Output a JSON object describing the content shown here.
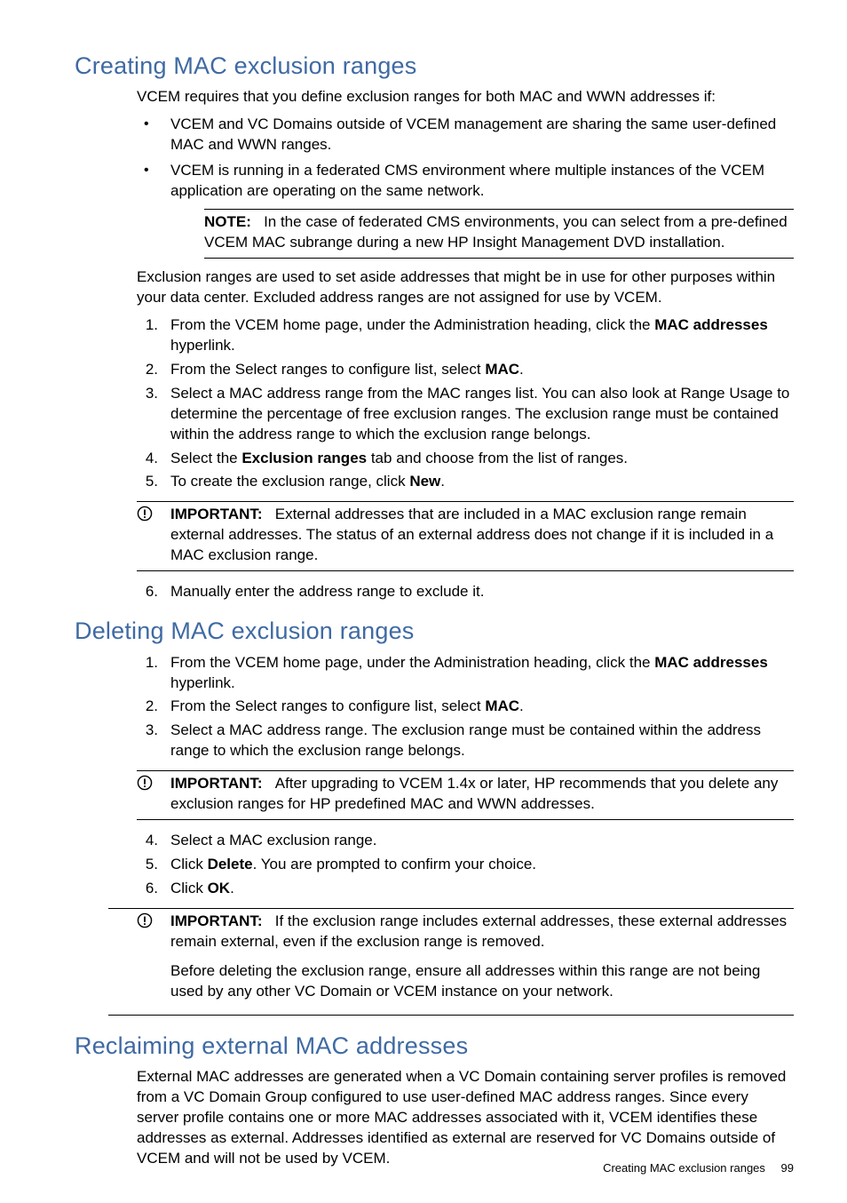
{
  "section1": {
    "heading": "Creating MAC exclusion ranges",
    "intro": "VCEM requires that you define exclusion ranges for both MAC and WWN addresses if:",
    "bullets": [
      "VCEM and VC Domains outside of VCEM management are sharing the same user-defined MAC and WWN ranges.",
      "VCEM is running in a federated CMS environment where multiple instances of the VCEM application are operating on the same network."
    ],
    "note_label": "NOTE:",
    "note_body": "In the case of federated CMS environments, you can select from a pre-defined VCEM MAC subrange during a new HP Insight Management DVD installation.",
    "para2": "Exclusion ranges are used to set aside addresses that might be in use for other purposes within your data center. Excluded address ranges are not assigned for use by VCEM.",
    "steps": {
      "s1a": "From the VCEM home page, under the Administration heading, click the ",
      "s1b": "MAC addresses",
      "s1c": " hyperlink.",
      "s2a": "From the Select ranges to configure list, select ",
      "s2b": "MAC",
      "s2c": ".",
      "s3": "Select a MAC address range from the MAC ranges list. You can also look at Range Usage to determine the percentage of free exclusion ranges. The exclusion range must be contained within the address range to which the exclusion range belongs.",
      "s4a": "Select the ",
      "s4b": "Exclusion ranges",
      "s4c": " tab and choose from the list of ranges.",
      "s5a": "To create the exclusion range, click ",
      "s5b": "New",
      "s5c": ".",
      "s6": "Manually enter the address range to exclude it."
    },
    "important_label": "IMPORTANT:",
    "important_body": "External addresses that are included in a MAC exclusion range remain external addresses. The status of an external address does not change if it is included in a MAC exclusion range."
  },
  "section2": {
    "heading": "Deleting MAC exclusion ranges",
    "steps": {
      "s1a": "From the VCEM home page, under the Administration heading, click the ",
      "s1b": "MAC addresses",
      "s1c": " hyperlink.",
      "s2a": "From the Select ranges to configure list, select ",
      "s2b": "MAC",
      "s2c": ".",
      "s3": "Select a MAC address range. The exclusion range must be contained within the address range to which the exclusion range belongs.",
      "s4": "Select a MAC exclusion range.",
      "s5a": "Click ",
      "s5b": "Delete",
      "s5c": ". You are prompted to confirm your choice.",
      "s6a": "Click ",
      "s6b": "OK",
      "s6c": "."
    },
    "important1_label": "IMPORTANT:",
    "important1_body": "After upgrading to VCEM 1.4x or later, HP recommends that you delete any exclusion ranges for HP predefined MAC and WWN addresses.",
    "important2_label": "IMPORTANT:",
    "important2_body": "If the exclusion range includes external addresses, these external addresses remain external, even if the exclusion range is removed.",
    "important2_body2": "Before deleting the exclusion range, ensure all addresses within this range are not being used by any other VC Domain or VCEM instance on your network."
  },
  "section3": {
    "heading": "Reclaiming external MAC addresses",
    "para": "External MAC addresses are generated when a VC Domain containing server profiles is removed from a VC Domain Group configured to use user-defined MAC address ranges. Since every server profile contains one or more MAC addresses associated with it, VCEM identifies these addresses as external. Addresses identified as external are reserved for VC Domains outside of VCEM and will not be used by VCEM."
  },
  "footer": {
    "title": "Creating MAC exclusion ranges",
    "page": "99"
  }
}
